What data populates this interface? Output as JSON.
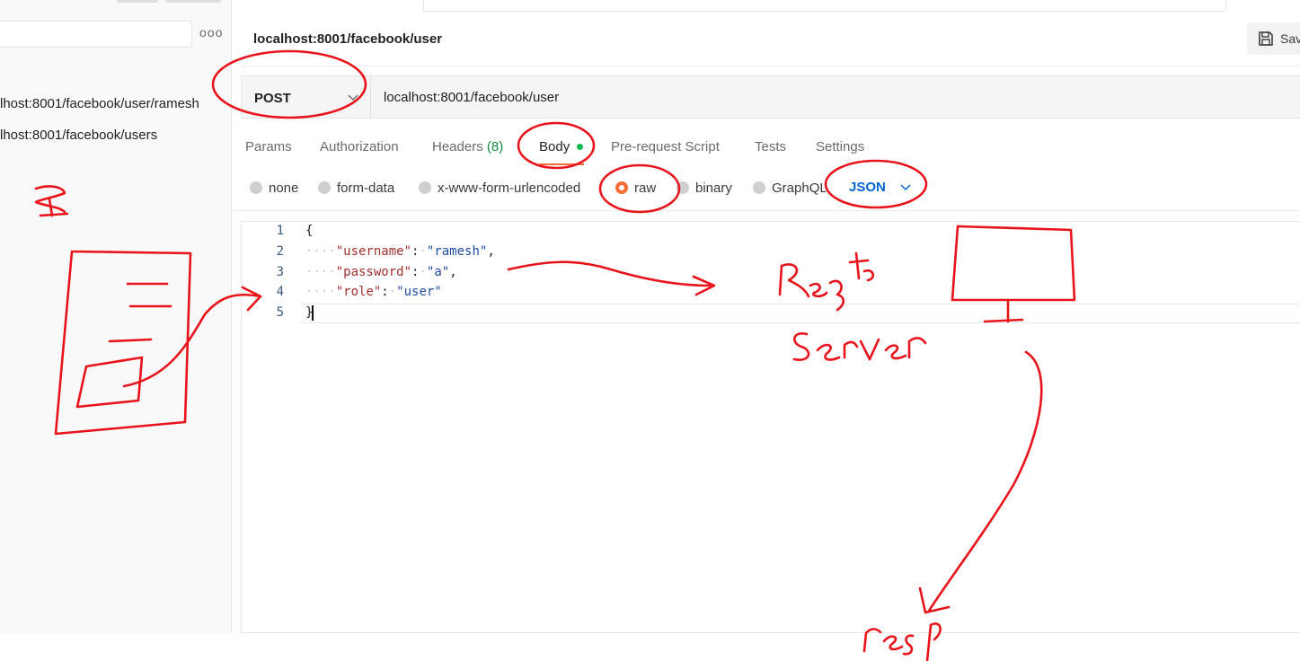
{
  "sidebar": {
    "more_glyph": "ooo",
    "items": [
      {
        "label": "lhost:8001/facebook/user/ramesh"
      },
      {
        "label": "lhost:8001/facebook/users"
      }
    ]
  },
  "request": {
    "title": "localhost:8001/facebook/user",
    "save_label": "Sav",
    "method": "POST",
    "url": "localhost:8001/facebook/user"
  },
  "tabs": {
    "params": "Params",
    "authorization": "Authorization",
    "headers": "Headers",
    "headers_count": "(8)",
    "body": "Body",
    "prerequest": "Pre-request Script",
    "tests": "Tests",
    "settings": "Settings"
  },
  "body_types": {
    "none": "none",
    "form_data": "form-data",
    "urlencoded": "x-www-form-urlencoded",
    "raw": "raw",
    "binary": "binary",
    "graphql": "GraphQL",
    "selected": "raw",
    "format": "JSON"
  },
  "editor": {
    "line_numbers": [
      "1",
      "2",
      "3",
      "4",
      "5"
    ],
    "open_brace": "{",
    "close_brace": "}",
    "fields": [
      {
        "key": "\"username\"",
        "value": "\"ramesh\"",
        "trail": ","
      },
      {
        "key": "\"password\"",
        "value": "\"a\"",
        "trail": ","
      },
      {
        "key": "\"role\"",
        "value": "\"user\"",
        "trail": ""
      }
    ]
  },
  "colors": {
    "accent": "#ff6c37",
    "json_blue": "#0265d2",
    "ink_red": "#e8141b",
    "body_dot": "#0cbb52"
  }
}
